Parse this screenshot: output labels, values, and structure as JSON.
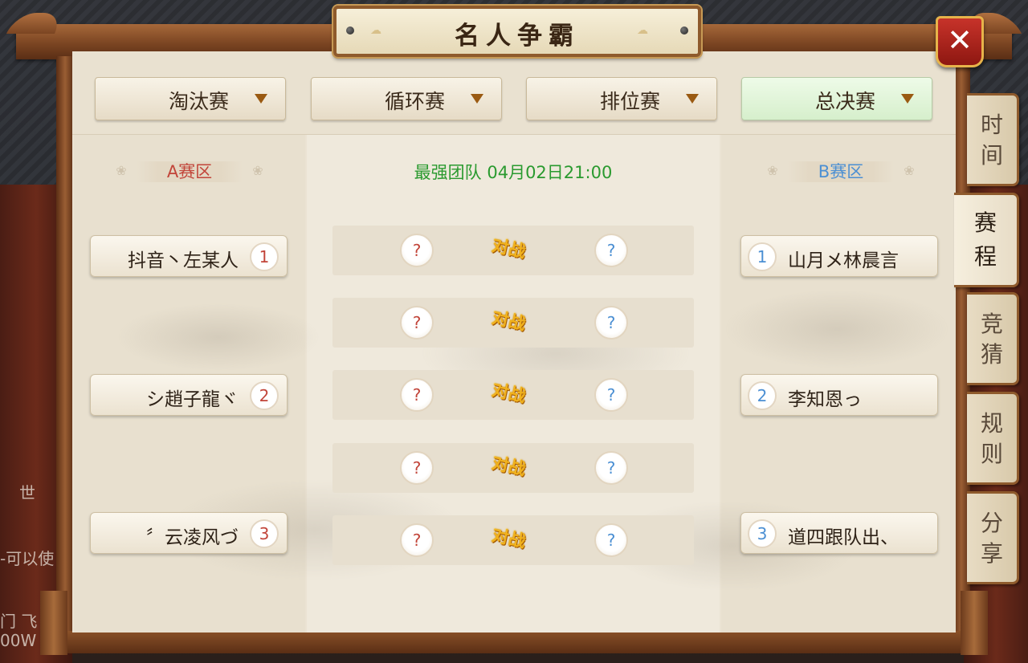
{
  "title": "名人争霸",
  "close_icon": "✕",
  "stage_tabs": [
    {
      "label": "淘汰赛",
      "active": false
    },
    {
      "label": "循环赛",
      "active": false
    },
    {
      "label": "排位赛",
      "active": false
    },
    {
      "label": "总决赛",
      "active": true
    }
  ],
  "zone_a": {
    "label": "A赛区",
    "color": "#c2453a"
  },
  "zone_b": {
    "label": "B赛区",
    "color": "#4b8fd3"
  },
  "center_info": "最强团队 04月02日21:00",
  "left_players": [
    {
      "name": "抖音丶左某人",
      "seed": "1"
    },
    {
      "name": "シ趙子龍ヾ",
      "seed": "2"
    },
    {
      "name": "〞云凌风づ",
      "seed": "3"
    }
  ],
  "right_players": [
    {
      "name": "山月メ林晨言",
      "seed": "1"
    },
    {
      "name": "李知恩っ",
      "seed": "2"
    },
    {
      "name": "道四跟队出、",
      "seed": "3"
    }
  ],
  "matches": [
    {
      "left": "?",
      "vs": "对战",
      "right": "?"
    },
    {
      "left": "?",
      "vs": "对战",
      "right": "?"
    },
    {
      "left": "?",
      "vs": "对战",
      "right": "?"
    },
    {
      "left": "?",
      "vs": "对战",
      "right": "?"
    },
    {
      "left": "?",
      "vs": "对战",
      "right": "?"
    }
  ],
  "side_tabs": [
    {
      "label_1": "时",
      "label_2": "间",
      "active": false
    },
    {
      "label_1": "赛",
      "label_2": "程",
      "active": true
    },
    {
      "label_1": "竞",
      "label_2": "猜",
      "active": false
    },
    {
      "label_1": "规",
      "label_2": "则",
      "active": false
    },
    {
      "label_1": "分",
      "label_2": "享",
      "active": false
    }
  ],
  "background_text": {
    "line1": "世",
    "line2": "-可以使",
    "line3": "门 飞",
    "line4": "00W"
  }
}
